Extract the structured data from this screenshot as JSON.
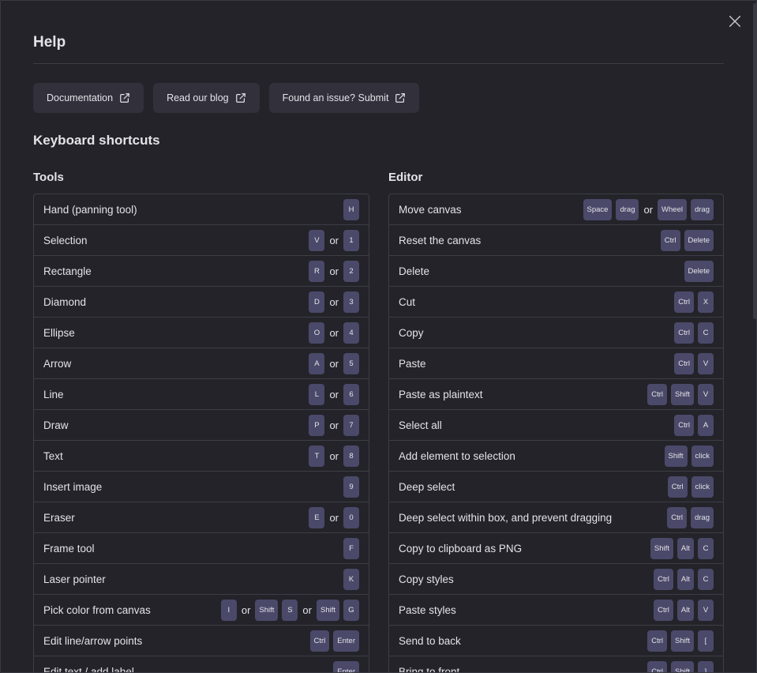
{
  "dialog": {
    "title": "Help",
    "close_icon": "close-icon"
  },
  "links": [
    {
      "label": "Documentation",
      "icon": "external-link-icon"
    },
    {
      "label": "Read our blog",
      "icon": "external-link-icon"
    },
    {
      "label": "Found an issue? Submit",
      "icon": "external-link-icon"
    }
  ],
  "shortcuts_heading": "Keyboard shortcuts",
  "or_text": "or",
  "tools": {
    "heading": "Tools",
    "items": [
      {
        "label": "Hand (panning tool)",
        "keys": [
          [
            "H"
          ]
        ]
      },
      {
        "label": "Selection",
        "keys": [
          [
            "V"
          ],
          [
            "1"
          ]
        ]
      },
      {
        "label": "Rectangle",
        "keys": [
          [
            "R"
          ],
          [
            "2"
          ]
        ]
      },
      {
        "label": "Diamond",
        "keys": [
          [
            "D"
          ],
          [
            "3"
          ]
        ]
      },
      {
        "label": "Ellipse",
        "keys": [
          [
            "O"
          ],
          [
            "4"
          ]
        ]
      },
      {
        "label": "Arrow",
        "keys": [
          [
            "A"
          ],
          [
            "5"
          ]
        ]
      },
      {
        "label": "Line",
        "keys": [
          [
            "L"
          ],
          [
            "6"
          ]
        ]
      },
      {
        "label": "Draw",
        "keys": [
          [
            "P"
          ],
          [
            "7"
          ]
        ]
      },
      {
        "label": "Text",
        "keys": [
          [
            "T"
          ],
          [
            "8"
          ]
        ]
      },
      {
        "label": "Insert image",
        "keys": [
          [
            "9"
          ]
        ]
      },
      {
        "label": "Eraser",
        "keys": [
          [
            "E"
          ],
          [
            "0"
          ]
        ]
      },
      {
        "label": "Frame tool",
        "keys": [
          [
            "F"
          ]
        ]
      },
      {
        "label": "Laser pointer",
        "keys": [
          [
            "K"
          ]
        ]
      },
      {
        "label": "Pick color from canvas",
        "keys": [
          [
            "I"
          ],
          [
            "Shift",
            "S"
          ],
          [
            "Shift",
            "G"
          ]
        ]
      },
      {
        "label": "Edit line/arrow points",
        "keys": [
          [
            "Ctrl",
            "Enter"
          ]
        ]
      },
      {
        "label": "Edit text / add label",
        "keys": [
          [
            "Enter"
          ]
        ]
      }
    ]
  },
  "editor": {
    "heading": "Editor",
    "items": [
      {
        "label": "Move canvas",
        "keys": [
          [
            "Space",
            "drag"
          ],
          [
            "Wheel",
            "drag"
          ]
        ]
      },
      {
        "label": "Reset the canvas",
        "keys": [
          [
            "Ctrl",
            "Delete"
          ]
        ]
      },
      {
        "label": "Delete",
        "keys": [
          [
            "Delete"
          ]
        ]
      },
      {
        "label": "Cut",
        "keys": [
          [
            "Ctrl",
            "X"
          ]
        ]
      },
      {
        "label": "Copy",
        "keys": [
          [
            "Ctrl",
            "C"
          ]
        ]
      },
      {
        "label": "Paste",
        "keys": [
          [
            "Ctrl",
            "V"
          ]
        ]
      },
      {
        "label": "Paste as plaintext",
        "keys": [
          [
            "Ctrl",
            "Shift",
            "V"
          ]
        ]
      },
      {
        "label": "Select all",
        "keys": [
          [
            "Ctrl",
            "A"
          ]
        ]
      },
      {
        "label": "Add element to selection",
        "keys": [
          [
            "Shift",
            "click"
          ]
        ]
      },
      {
        "label": "Deep select",
        "keys": [
          [
            "Ctrl",
            "click"
          ]
        ]
      },
      {
        "label": "Deep select within box, and prevent dragging",
        "keys": [
          [
            "Ctrl",
            "drag"
          ]
        ]
      },
      {
        "label": "Copy to clipboard as PNG",
        "keys": [
          [
            "Shift",
            "Alt",
            "C"
          ]
        ]
      },
      {
        "label": "Copy styles",
        "keys": [
          [
            "Ctrl",
            "Alt",
            "C"
          ]
        ]
      },
      {
        "label": "Paste styles",
        "keys": [
          [
            "Ctrl",
            "Alt",
            "V"
          ]
        ]
      },
      {
        "label": "Send to back",
        "keys": [
          [
            "Ctrl",
            "Shift",
            "["
          ]
        ]
      },
      {
        "label": "Bring to front",
        "keys": [
          [
            "Ctrl",
            "Shift",
            "]"
          ]
        ]
      }
    ]
  }
}
